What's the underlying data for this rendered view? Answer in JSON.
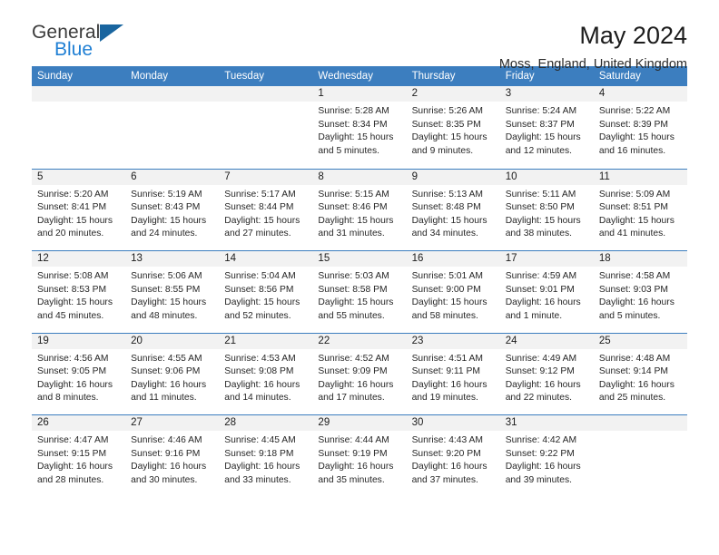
{
  "brand": {
    "name_part1": "General",
    "name_part2": "Blue",
    "accent_color": "#1f7fd4",
    "triangle_color": "#19659f"
  },
  "header": {
    "title": "May 2024",
    "subtitle": "Moss, England, United Kingdom",
    "header_bg_color": "#3c7ebf"
  },
  "weekdays": [
    "Sunday",
    "Monday",
    "Tuesday",
    "Wednesday",
    "Thursday",
    "Friday",
    "Saturday"
  ],
  "labels": {
    "sunrise": "Sunrise:",
    "sunset": "Sunset:",
    "daylight": "Daylight:"
  },
  "weeks": [
    [
      {
        "day": "",
        "sunrise": "",
        "sunset": "",
        "daylight_line1": "",
        "daylight_line2": ""
      },
      {
        "day": "",
        "sunrise": "",
        "sunset": "",
        "daylight_line1": "",
        "daylight_line2": ""
      },
      {
        "day": "",
        "sunrise": "",
        "sunset": "",
        "daylight_line1": "",
        "daylight_line2": ""
      },
      {
        "day": "1",
        "sunrise": "Sunrise: 5:28 AM",
        "sunset": "Sunset: 8:34 PM",
        "daylight_line1": "Daylight: 15 hours",
        "daylight_line2": "and 5 minutes."
      },
      {
        "day": "2",
        "sunrise": "Sunrise: 5:26 AM",
        "sunset": "Sunset: 8:35 PM",
        "daylight_line1": "Daylight: 15 hours",
        "daylight_line2": "and 9 minutes."
      },
      {
        "day": "3",
        "sunrise": "Sunrise: 5:24 AM",
        "sunset": "Sunset: 8:37 PM",
        "daylight_line1": "Daylight: 15 hours",
        "daylight_line2": "and 12 minutes."
      },
      {
        "day": "4",
        "sunrise": "Sunrise: 5:22 AM",
        "sunset": "Sunset: 8:39 PM",
        "daylight_line1": "Daylight: 15 hours",
        "daylight_line2": "and 16 minutes."
      }
    ],
    [
      {
        "day": "5",
        "sunrise": "Sunrise: 5:20 AM",
        "sunset": "Sunset: 8:41 PM",
        "daylight_line1": "Daylight: 15 hours",
        "daylight_line2": "and 20 minutes."
      },
      {
        "day": "6",
        "sunrise": "Sunrise: 5:19 AM",
        "sunset": "Sunset: 8:43 PM",
        "daylight_line1": "Daylight: 15 hours",
        "daylight_line2": "and 24 minutes."
      },
      {
        "day": "7",
        "sunrise": "Sunrise: 5:17 AM",
        "sunset": "Sunset: 8:44 PM",
        "daylight_line1": "Daylight: 15 hours",
        "daylight_line2": "and 27 minutes."
      },
      {
        "day": "8",
        "sunrise": "Sunrise: 5:15 AM",
        "sunset": "Sunset: 8:46 PM",
        "daylight_line1": "Daylight: 15 hours",
        "daylight_line2": "and 31 minutes."
      },
      {
        "day": "9",
        "sunrise": "Sunrise: 5:13 AM",
        "sunset": "Sunset: 8:48 PM",
        "daylight_line1": "Daylight: 15 hours",
        "daylight_line2": "and 34 minutes."
      },
      {
        "day": "10",
        "sunrise": "Sunrise: 5:11 AM",
        "sunset": "Sunset: 8:50 PM",
        "daylight_line1": "Daylight: 15 hours",
        "daylight_line2": "and 38 minutes."
      },
      {
        "day": "11",
        "sunrise": "Sunrise: 5:09 AM",
        "sunset": "Sunset: 8:51 PM",
        "daylight_line1": "Daylight: 15 hours",
        "daylight_line2": "and 41 minutes."
      }
    ],
    [
      {
        "day": "12",
        "sunrise": "Sunrise: 5:08 AM",
        "sunset": "Sunset: 8:53 PM",
        "daylight_line1": "Daylight: 15 hours",
        "daylight_line2": "and 45 minutes."
      },
      {
        "day": "13",
        "sunrise": "Sunrise: 5:06 AM",
        "sunset": "Sunset: 8:55 PM",
        "daylight_line1": "Daylight: 15 hours",
        "daylight_line2": "and 48 minutes."
      },
      {
        "day": "14",
        "sunrise": "Sunrise: 5:04 AM",
        "sunset": "Sunset: 8:56 PM",
        "daylight_line1": "Daylight: 15 hours",
        "daylight_line2": "and 52 minutes."
      },
      {
        "day": "15",
        "sunrise": "Sunrise: 5:03 AM",
        "sunset": "Sunset: 8:58 PM",
        "daylight_line1": "Daylight: 15 hours",
        "daylight_line2": "and 55 minutes."
      },
      {
        "day": "16",
        "sunrise": "Sunrise: 5:01 AM",
        "sunset": "Sunset: 9:00 PM",
        "daylight_line1": "Daylight: 15 hours",
        "daylight_line2": "and 58 minutes."
      },
      {
        "day": "17",
        "sunrise": "Sunrise: 4:59 AM",
        "sunset": "Sunset: 9:01 PM",
        "daylight_line1": "Daylight: 16 hours",
        "daylight_line2": "and 1 minute."
      },
      {
        "day": "18",
        "sunrise": "Sunrise: 4:58 AM",
        "sunset": "Sunset: 9:03 PM",
        "daylight_line1": "Daylight: 16 hours",
        "daylight_line2": "and 5 minutes."
      }
    ],
    [
      {
        "day": "19",
        "sunrise": "Sunrise: 4:56 AM",
        "sunset": "Sunset: 9:05 PM",
        "daylight_line1": "Daylight: 16 hours",
        "daylight_line2": "and 8 minutes."
      },
      {
        "day": "20",
        "sunrise": "Sunrise: 4:55 AM",
        "sunset": "Sunset: 9:06 PM",
        "daylight_line1": "Daylight: 16 hours",
        "daylight_line2": "and 11 minutes."
      },
      {
        "day": "21",
        "sunrise": "Sunrise: 4:53 AM",
        "sunset": "Sunset: 9:08 PM",
        "daylight_line1": "Daylight: 16 hours",
        "daylight_line2": "and 14 minutes."
      },
      {
        "day": "22",
        "sunrise": "Sunrise: 4:52 AM",
        "sunset": "Sunset: 9:09 PM",
        "daylight_line1": "Daylight: 16 hours",
        "daylight_line2": "and 17 minutes."
      },
      {
        "day": "23",
        "sunrise": "Sunrise: 4:51 AM",
        "sunset": "Sunset: 9:11 PM",
        "daylight_line1": "Daylight: 16 hours",
        "daylight_line2": "and 19 minutes."
      },
      {
        "day": "24",
        "sunrise": "Sunrise: 4:49 AM",
        "sunset": "Sunset: 9:12 PM",
        "daylight_line1": "Daylight: 16 hours",
        "daylight_line2": "and 22 minutes."
      },
      {
        "day": "25",
        "sunrise": "Sunrise: 4:48 AM",
        "sunset": "Sunset: 9:14 PM",
        "daylight_line1": "Daylight: 16 hours",
        "daylight_line2": "and 25 minutes."
      }
    ],
    [
      {
        "day": "26",
        "sunrise": "Sunrise: 4:47 AM",
        "sunset": "Sunset: 9:15 PM",
        "daylight_line1": "Daylight: 16 hours",
        "daylight_line2": "and 28 minutes."
      },
      {
        "day": "27",
        "sunrise": "Sunrise: 4:46 AM",
        "sunset": "Sunset: 9:16 PM",
        "daylight_line1": "Daylight: 16 hours",
        "daylight_line2": "and 30 minutes."
      },
      {
        "day": "28",
        "sunrise": "Sunrise: 4:45 AM",
        "sunset": "Sunset: 9:18 PM",
        "daylight_line1": "Daylight: 16 hours",
        "daylight_line2": "and 33 minutes."
      },
      {
        "day": "29",
        "sunrise": "Sunrise: 4:44 AM",
        "sunset": "Sunset: 9:19 PM",
        "daylight_line1": "Daylight: 16 hours",
        "daylight_line2": "and 35 minutes."
      },
      {
        "day": "30",
        "sunrise": "Sunrise: 4:43 AM",
        "sunset": "Sunset: 9:20 PM",
        "daylight_line1": "Daylight: 16 hours",
        "daylight_line2": "and 37 minutes."
      },
      {
        "day": "31",
        "sunrise": "Sunrise: 4:42 AM",
        "sunset": "Sunset: 9:22 PM",
        "daylight_line1": "Daylight: 16 hours",
        "daylight_line2": "and 39 minutes."
      },
      {
        "day": "",
        "sunrise": "",
        "sunset": "",
        "daylight_line1": "",
        "daylight_line2": ""
      }
    ]
  ]
}
